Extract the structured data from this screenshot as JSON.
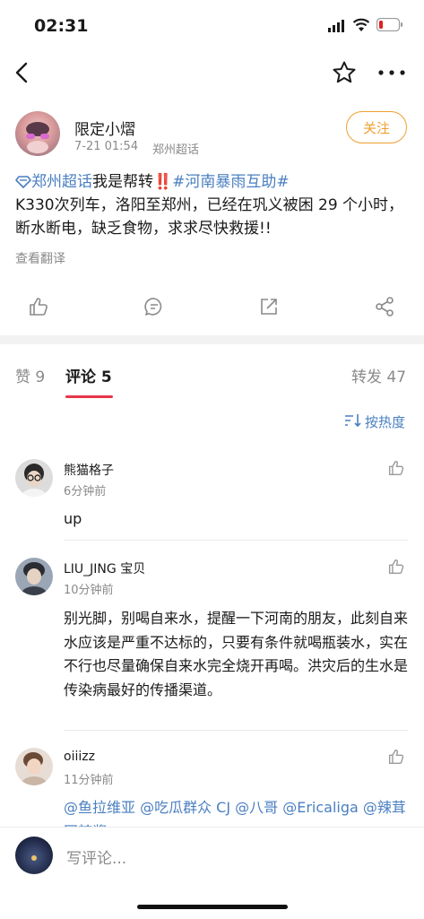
{
  "status_bar": {
    "time": "02:31"
  },
  "nav": {
    "back_icon": "chevron-left-icon",
    "favorite_icon": "star-icon",
    "more_icon": "more-icon"
  },
  "post": {
    "author": "限定小熠",
    "time": "7-21 01:54",
    "source": "郑州超话",
    "follow_label": "关注",
    "text": {
      "topic": "郑州超话",
      "lead": "我是帮转",
      "alarm": "‼️",
      "hashtag": "#河南暴雨互助#",
      "body": "K330次列车，洛阳至郑州，已经在巩义被困 29 个小时，断水断电，缺乏食物，求求尽快救援!!"
    },
    "translate_label": "查看翻译"
  },
  "action_bar": {
    "like": "like-icon",
    "comment": "comment-icon",
    "share": "share-icon",
    "forward": "forward-icon"
  },
  "tabs": {
    "likes": "赞 9",
    "comments": "评论 5",
    "reposts": "转发 47"
  },
  "sort": {
    "label": "按热度"
  },
  "comments": [
    {
      "name": "熊猫格子",
      "time": "6分钟前",
      "text": "up"
    },
    {
      "name": "LIU_JING 宝贝",
      "time": "10分钟前",
      "text": "别光脚，别喝自来水，提醒一下河南的朋友，此刻自来水应该是严重不达标的，只要有条件就喝瓶装水，实在不行也尽量确保自来水完全烧开再喝。洪灾后的生水是传染病最好的传播渠道。"
    },
    {
      "name": "oiiizz",
      "time": "11分钟前",
      "mentions": "@鱼拉维亚 @吃瓜群众 CJ @八哥 @Ericaliga @辣茸困辣酱"
    }
  ],
  "composer": {
    "placeholder": "写评论..."
  },
  "colors": {
    "link": "#4a7fc1",
    "follow": "#f0a030",
    "tab_underline": "#e8364a",
    "alarm": "#e02020"
  }
}
